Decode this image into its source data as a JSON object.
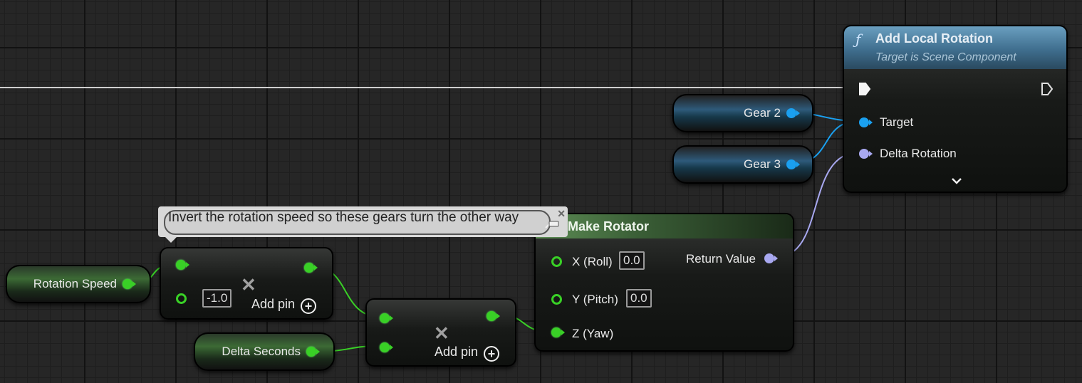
{
  "colors": {
    "float_pin": "#39d026",
    "object_pin": "#1aa0f0",
    "rotator_pin": "#a8a8f0",
    "function_header": "#3f6e8e",
    "make_header": "#4a7a45"
  },
  "add_local_rotation": {
    "icon": "function-icon",
    "title": "Add Local Rotation",
    "subtitle": "Target is Scene Component",
    "pins": {
      "target": "Target",
      "delta_rotation": "Delta Rotation"
    },
    "expand_icon": "chevron-down-icon"
  },
  "variables": {
    "gear2": "Gear 2",
    "gear3": "Gear 3",
    "rotation_speed": "Rotation Speed",
    "delta_seconds": "Delta Seconds"
  },
  "comment": {
    "text": "Invert the rotation speed so these gears turn the other way"
  },
  "multiply_node_1": {
    "default_value": "-1.0",
    "add_pin": "Add pin"
  },
  "multiply_node_2": {
    "add_pin": "Add pin"
  },
  "make_rotator": {
    "title": "Make Rotator",
    "pins": {
      "x": "X (Roll)",
      "x_value": "0.0",
      "y": "Y (Pitch)",
      "y_value": "0.0",
      "z": "Z (Yaw)",
      "return": "Return Value"
    }
  }
}
